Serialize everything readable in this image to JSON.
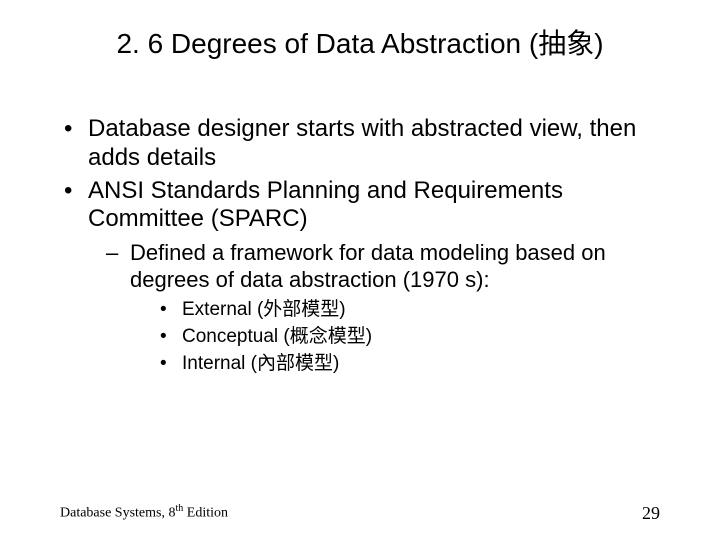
{
  "title": "2. 6 Degrees of Data Abstraction (抽象)",
  "bullets": {
    "b1": "Database designer starts with abstracted view, then adds details",
    "b2": "ANSI Standards Planning and Requirements Committee (SPARC)",
    "b2_1": "Defined a framework for data modeling based on degrees of data abstraction (1970 s):",
    "b2_1_1": "External (外部模型)",
    "b2_1_2": "Conceptual (概念模型)",
    "b2_1_3": "Internal (內部模型)"
  },
  "footer": {
    "book_prefix": "Database Systems, 8",
    "ordinal": "th",
    "book_suffix": " Edition",
    "page": "29"
  }
}
